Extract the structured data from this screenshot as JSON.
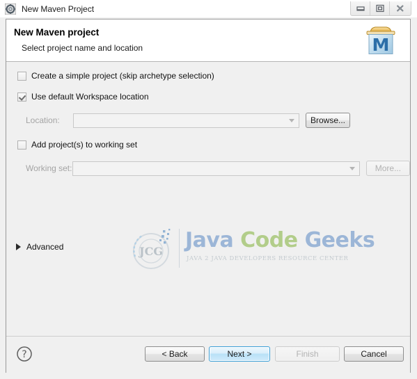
{
  "window": {
    "title": "New Maven Project",
    "icon": "maven-gear-icon",
    "controls": [
      {
        "name": "minimize",
        "glyph": "minimize-icon"
      },
      {
        "name": "restore",
        "glyph": "restore-icon"
      },
      {
        "name": "close",
        "glyph": "close-icon"
      }
    ]
  },
  "banner": {
    "title": "New Maven project",
    "subtitle": "Select project name and location",
    "icon": "maven-project-box-icon"
  },
  "content": {
    "simple_project": {
      "label": "Create a simple project (skip archetype selection)",
      "checked": false
    },
    "default_workspace": {
      "label": "Use default Workspace location",
      "checked": true
    },
    "location": {
      "label": "Location:",
      "value": "",
      "placeholder": "",
      "enabled": false,
      "browse_label": "Browse...",
      "browse_enabled": true
    },
    "working_set_checkbox": {
      "label": "Add project(s) to working set",
      "checked": false
    },
    "working_set": {
      "label": "Working set:",
      "value": "",
      "placeholder": "",
      "enabled": false,
      "more_label": "More...",
      "more_enabled": false
    },
    "advanced": {
      "label": "Advanced",
      "expanded": false
    }
  },
  "watermark": {
    "logo_text": "JCG",
    "word_java": "Java ",
    "word_code": "Code ",
    "word_geeks": "Geeks",
    "tagline": "JAVA 2 JAVA DEVELOPERS RESOURCE CENTER"
  },
  "buttonbar": {
    "help_icon": "help-question-icon",
    "buttons": [
      {
        "label": "< Back",
        "enabled": true,
        "default": false
      },
      {
        "label": "Next >",
        "enabled": true,
        "default": true
      },
      {
        "label": "Finish",
        "enabled": false,
        "default": false
      },
      {
        "label": "Cancel",
        "enabled": true,
        "default": false
      }
    ]
  },
  "colors": {
    "accent": "#3c9fd6",
    "dialog_bg": "#f0f0f0",
    "banner_bg": "#ffffff",
    "watermark_blue": "#6a93c8",
    "watermark_green": "#8db84c"
  }
}
